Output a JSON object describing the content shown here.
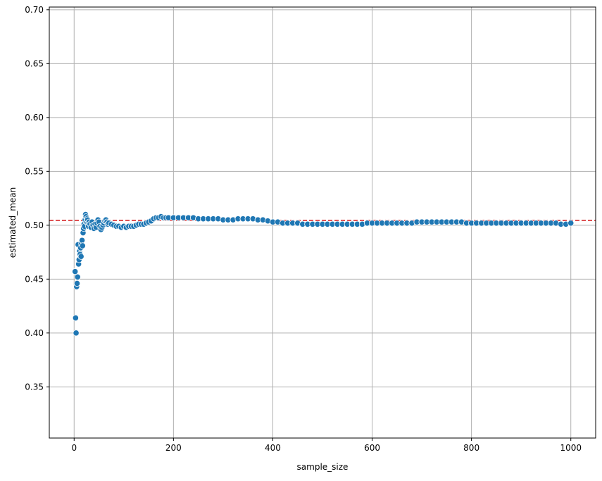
{
  "chart_data": {
    "type": "scatter",
    "title": "",
    "xlabel": "sample_size",
    "ylabel": "estimated_mean",
    "xlim": [
      -50,
      1050
    ],
    "ylim": [
      0.3025,
      0.7025
    ],
    "x_ticks": [
      0,
      200,
      400,
      600,
      800,
      1000
    ],
    "y_ticks": [
      0.35,
      0.4,
      0.45,
      0.5,
      0.55,
      0.6,
      0.65,
      0.7
    ],
    "x_tick_labels": [
      "0",
      "200",
      "400",
      "600",
      "800",
      "1000"
    ],
    "y_tick_labels": [
      "0.35",
      "0.40",
      "0.45",
      "0.50",
      "0.55",
      "0.60",
      "0.65",
      "0.70"
    ],
    "grid": true,
    "reference_line": {
      "y": 0.5045,
      "style": "dashed",
      "color": "#d62728"
    },
    "marker_color": "#1f77b4",
    "marker_edge_color": "#ffffff",
    "points": [
      [
        2,
        0.457
      ],
      [
        3,
        0.414
      ],
      [
        4,
        0.4
      ],
      [
        5,
        0.443
      ],
      [
        6,
        0.446
      ],
      [
        7,
        0.452
      ],
      [
        8,
        0.482
      ],
      [
        9,
        0.464
      ],
      [
        10,
        0.468
      ],
      [
        11,
        0.476
      ],
      [
        12,
        0.473
      ],
      [
        13,
        0.479
      ],
      [
        14,
        0.471
      ],
      [
        15,
        0.483
      ],
      [
        16,
        0.486
      ],
      [
        17,
        0.481
      ],
      [
        18,
        0.493
      ],
      [
        19,
        0.497
      ],
      [
        20,
        0.501
      ],
      [
        21,
        0.499
      ],
      [
        22,
        0.505
      ],
      [
        23,
        0.51
      ],
      [
        24,
        0.508
      ],
      [
        25,
        0.503
      ],
      [
        26,
        0.506
      ],
      [
        27,
        0.505
      ],
      [
        28,
        0.502
      ],
      [
        29,
        0.499
      ],
      [
        30,
        0.503
      ],
      [
        32,
        0.501
      ],
      [
        34,
        0.498
      ],
      [
        36,
        0.503
      ],
      [
        38,
        0.5
      ],
      [
        40,
        0.497
      ],
      [
        42,
        0.501
      ],
      [
        44,
        0.498
      ],
      [
        46,
        0.502
      ],
      [
        48,
        0.505
      ],
      [
        50,
        0.503
      ],
      [
        52,
        0.499
      ],
      [
        54,
        0.496
      ],
      [
        56,
        0.498
      ],
      [
        58,
        0.5
      ],
      [
        60,
        0.502
      ],
      [
        62,
        0.504
      ],
      [
        64,
        0.505
      ],
      [
        66,
        0.503
      ],
      [
        68,
        0.501
      ],
      [
        70,
        0.502
      ],
      [
        75,
        0.501
      ],
      [
        80,
        0.5
      ],
      [
        85,
        0.499
      ],
      [
        90,
        0.499
      ],
      [
        95,
        0.498
      ],
      [
        100,
        0.499
      ],
      [
        105,
        0.498
      ],
      [
        110,
        0.499
      ],
      [
        115,
        0.499
      ],
      [
        120,
        0.499
      ],
      [
        125,
        0.5
      ],
      [
        130,
        0.501
      ],
      [
        135,
        0.501
      ],
      [
        140,
        0.501
      ],
      [
        145,
        0.502
      ],
      [
        150,
        0.503
      ],
      [
        155,
        0.504
      ],
      [
        160,
        0.506
      ],
      [
        165,
        0.507
      ],
      [
        170,
        0.507
      ],
      [
        175,
        0.508
      ],
      [
        180,
        0.507
      ],
      [
        185,
        0.507
      ],
      [
        190,
        0.507
      ],
      [
        200,
        0.507
      ],
      [
        210,
        0.507
      ],
      [
        220,
        0.507
      ],
      [
        230,
        0.507
      ],
      [
        240,
        0.507
      ],
      [
        250,
        0.506
      ],
      [
        260,
        0.506
      ],
      [
        270,
        0.506
      ],
      [
        280,
        0.506
      ],
      [
        290,
        0.506
      ],
      [
        300,
        0.505
      ],
      [
        310,
        0.505
      ],
      [
        320,
        0.505
      ],
      [
        330,
        0.506
      ],
      [
        340,
        0.506
      ],
      [
        350,
        0.506
      ],
      [
        360,
        0.506
      ],
      [
        370,
        0.505
      ],
      [
        380,
        0.505
      ],
      [
        390,
        0.504
      ],
      [
        400,
        0.503
      ],
      [
        410,
        0.503
      ],
      [
        420,
        0.502
      ],
      [
        430,
        0.502
      ],
      [
        440,
        0.502
      ],
      [
        450,
        0.502
      ],
      [
        460,
        0.501
      ],
      [
        470,
        0.501
      ],
      [
        480,
        0.501
      ],
      [
        490,
        0.501
      ],
      [
        500,
        0.501
      ],
      [
        510,
        0.501
      ],
      [
        520,
        0.501
      ],
      [
        530,
        0.501
      ],
      [
        540,
        0.501
      ],
      [
        550,
        0.501
      ],
      [
        560,
        0.501
      ],
      [
        570,
        0.501
      ],
      [
        580,
        0.501
      ],
      [
        590,
        0.502
      ],
      [
        600,
        0.502
      ],
      [
        610,
        0.502
      ],
      [
        620,
        0.502
      ],
      [
        630,
        0.502
      ],
      [
        640,
        0.502
      ],
      [
        650,
        0.502
      ],
      [
        660,
        0.502
      ],
      [
        670,
        0.502
      ],
      [
        680,
        0.502
      ],
      [
        690,
        0.503
      ],
      [
        700,
        0.503
      ],
      [
        710,
        0.503
      ],
      [
        720,
        0.503
      ],
      [
        730,
        0.503
      ],
      [
        740,
        0.503
      ],
      [
        750,
        0.503
      ],
      [
        760,
        0.503
      ],
      [
        770,
        0.503
      ],
      [
        780,
        0.503
      ],
      [
        790,
        0.502
      ],
      [
        800,
        0.502
      ],
      [
        810,
        0.502
      ],
      [
        820,
        0.502
      ],
      [
        830,
        0.502
      ],
      [
        840,
        0.502
      ],
      [
        850,
        0.502
      ],
      [
        860,
        0.502
      ],
      [
        870,
        0.502
      ],
      [
        880,
        0.502
      ],
      [
        890,
        0.502
      ],
      [
        900,
        0.502
      ],
      [
        910,
        0.502
      ],
      [
        920,
        0.502
      ],
      [
        930,
        0.502
      ],
      [
        940,
        0.502
      ],
      [
        950,
        0.502
      ],
      [
        960,
        0.502
      ],
      [
        970,
        0.502
      ],
      [
        980,
        0.501
      ],
      [
        990,
        0.501
      ],
      [
        1000,
        0.502
      ]
    ]
  }
}
